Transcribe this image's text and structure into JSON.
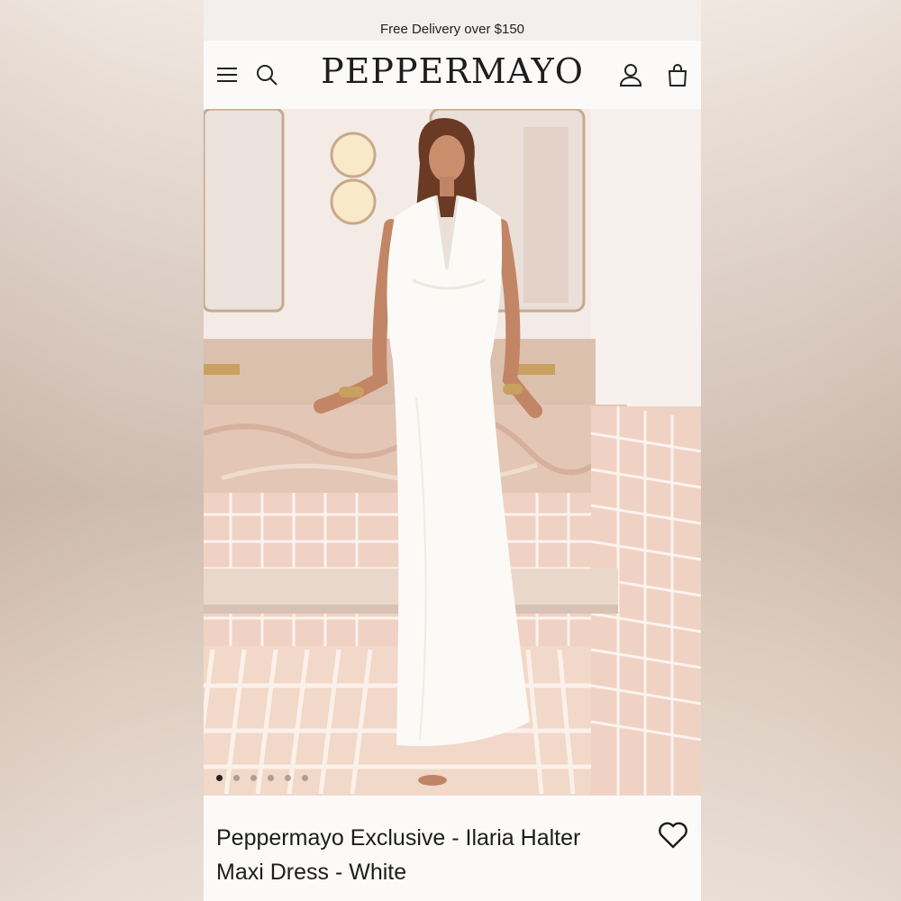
{
  "promo": {
    "text": "Free Delivery over $150"
  },
  "header": {
    "logo": "PEPPERMAYO",
    "icons": [
      "menu-icon",
      "search-icon",
      "account-icon",
      "bag-icon"
    ]
  },
  "gallery": {
    "image": "model in white halter maxi dress standing in pink tiled bathroom",
    "total_images": 6,
    "active_index": 0
  },
  "product": {
    "title": "Peppermayo Exclusive - Ilaria Halter Maxi Dress - White",
    "wishlist_icon": "heart-outline-icon"
  },
  "colors": {
    "text": "#1d1d1d",
    "background": "#fbfaf9",
    "tile": "#ecc9b9",
    "marble": "#e2c3b3"
  }
}
